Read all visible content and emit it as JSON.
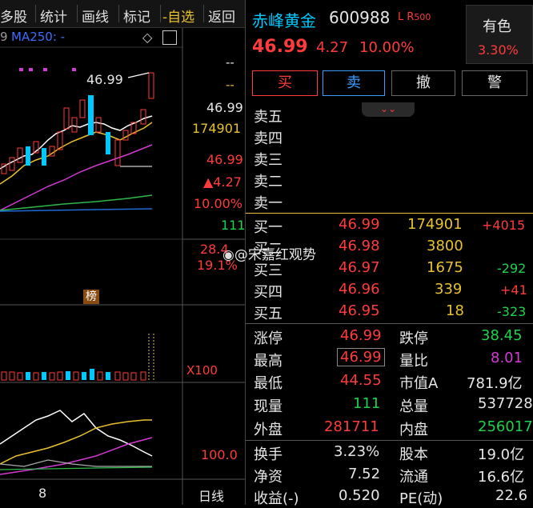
{
  "toolbar": {
    "items": [
      "多股",
      "统计",
      "画线",
      "标记",
      "-自选",
      "返回"
    ]
  },
  "chart": {
    "ma_legend_prefix": "9",
    "ma_legend": "MA250: -",
    "peak_label": "46.99",
    "axis_dash1": "--",
    "axis_dash2": "--",
    "price_1": "46.99",
    "vol_1": "174901",
    "price_2": "46.99",
    "change": "▲4.27",
    "change_pct": "10.00%",
    "cur_vol": "111",
    "v_28": "28.4",
    "pct_19": "19.1%",
    "bang_label": "榜",
    "x100_label": "X100",
    "sub_value": "100.0",
    "date_tick": "8",
    "period_label": "日线",
    "watermark": "@宋嘉红观势"
  },
  "header": {
    "name": "赤峰黄金",
    "code": "600988",
    "flags": "L R",
    "flag_num": "500",
    "price": "46.99",
    "change": "4.27",
    "change_pct": "10.00%",
    "sector": "有色",
    "sector_pct": "3.30%"
  },
  "buttons": {
    "buy": "买",
    "sell": "卖",
    "cancel": "撤",
    "alert": "警"
  },
  "sell_levels": [
    "卖五",
    "卖四",
    "卖三",
    "卖二",
    "卖一"
  ],
  "buy_levels": [
    {
      "label": "买一",
      "price": "46.99",
      "vol": "174901",
      "delta": "+4015"
    },
    {
      "label": "买二",
      "price": "46.98",
      "vol": "3800",
      "delta": ""
    },
    {
      "label": "买三",
      "price": "46.97",
      "vol": "1675",
      "delta": "-292"
    },
    {
      "label": "买四",
      "price": "46.96",
      "vol": "339",
      "delta": "+41"
    },
    {
      "label": "买五",
      "price": "46.95",
      "vol": "18",
      "delta": "-323"
    }
  ],
  "stats": [
    {
      "l1": "涨停",
      "v1": "46.99",
      "l2": "跌停",
      "v2": "38.45"
    },
    {
      "l1": "最高",
      "v1": "46.99",
      "l2": "量比",
      "v2": "8.01"
    },
    {
      "l1": "最低",
      "v1": "44.55",
      "l2": "市值A",
      "v2": "781.9亿"
    },
    {
      "l1": "现量",
      "v1": "111",
      "l2": "总量",
      "v2": "537728"
    },
    {
      "l1": "外盘",
      "v1": "281711",
      "l2": "内盘",
      "v2": "256017"
    }
  ],
  "stats2": [
    {
      "l1": "换手",
      "v1": "3.23%",
      "l2": "股本",
      "v2": "19.0亿"
    },
    {
      "l1": "净资",
      "v1": "7.52",
      "l2": "流通",
      "v2": "16.6亿"
    },
    {
      "l1": "收益(-)",
      "v1": "0.520",
      "l2": "PE(动)",
      "v2": "22.6"
    }
  ],
  "colors": {
    "up": "#ff3b3b",
    "down": "#1ed24b",
    "accent": "#00c8ff"
  }
}
